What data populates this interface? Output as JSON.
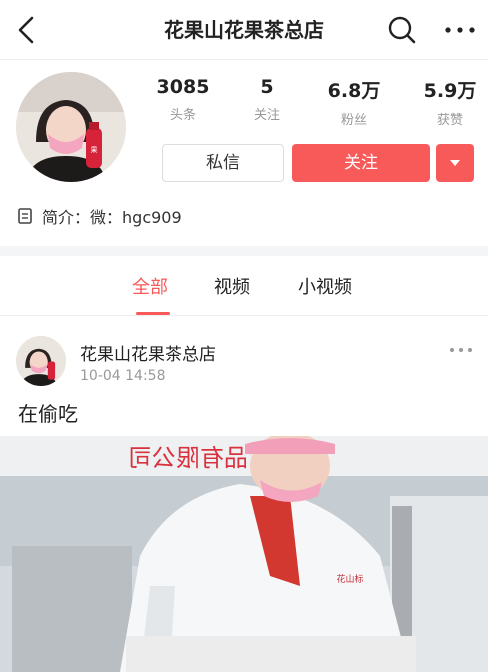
{
  "header": {
    "title": "花果山花果茶总店",
    "back_icon": "chevron-left-icon",
    "search_icon": "search-icon",
    "more_icon": "more-horizontal-icon"
  },
  "profile": {
    "stats": [
      {
        "value": "3085",
        "label": "头条"
      },
      {
        "value": "5",
        "label": "关注"
      },
      {
        "value": "6.8万",
        "label": "粉丝"
      },
      {
        "value": "5.9万",
        "label": "获赞"
      }
    ],
    "message_label": "私信",
    "follow_label": "关注",
    "bio_prefix": "简介：",
    "bio_text": "微：hgc909"
  },
  "tabs": [
    {
      "label": "全部",
      "active": true
    },
    {
      "label": "视频",
      "active": false
    },
    {
      "label": "小视频",
      "active": false
    }
  ],
  "post": {
    "author": "花果山花果茶总店",
    "time": "10-04 14:58",
    "text": "在偷吃",
    "image_sign_text": "食品有限公司",
    "uniform_text": "花山标"
  },
  "colors": {
    "accent": "#f85959",
    "muted": "#999999",
    "divider": "#f4f5f6"
  }
}
